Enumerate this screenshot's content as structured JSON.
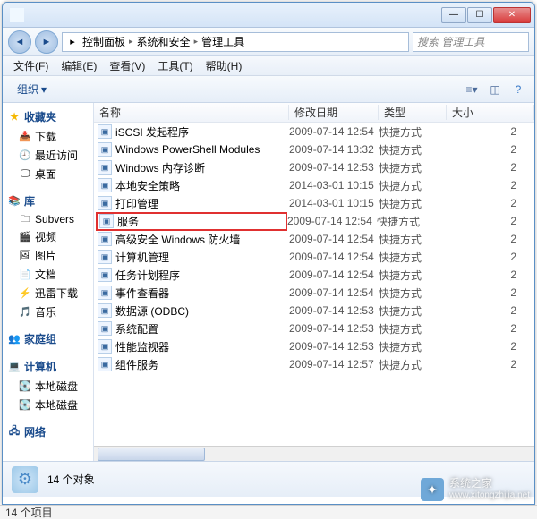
{
  "title": "",
  "win_buttons": {
    "min": "—",
    "max": "☐",
    "close": "✕"
  },
  "breadcrumb": [
    "控制面板",
    "系统和安全",
    "管理工具"
  ],
  "search_placeholder": "搜索 管理工具",
  "menus": [
    "文件(F)",
    "编辑(E)",
    "查看(V)",
    "工具(T)",
    "帮助(H)"
  ],
  "toolbar": {
    "organize": "组织",
    "organize_caret": "▾"
  },
  "sidebar": {
    "favorites": {
      "label": "收藏夹",
      "items": [
        "下载",
        "最近访问",
        "桌面"
      ]
    },
    "library": {
      "label": "库",
      "items": [
        "Subvers",
        "视频",
        "图片",
        "文档",
        "迅雷下载",
        "音乐"
      ]
    },
    "homegroup": {
      "label": "家庭组"
    },
    "computer": {
      "label": "计算机",
      "items": [
        "本地磁盘",
        "本地磁盘"
      ]
    },
    "network": {
      "label": "网络"
    }
  },
  "columns": {
    "name": "名称",
    "date": "修改日期",
    "type": "类型",
    "size": "大小"
  },
  "files": [
    {
      "name": "iSCSI 发起程序",
      "date": "2009-07-14 12:54",
      "type": "快捷方式",
      "size": "2"
    },
    {
      "name": "Windows PowerShell Modules",
      "date": "2009-07-14 13:32",
      "type": "快捷方式",
      "size": "2"
    },
    {
      "name": "Windows 内存诊断",
      "date": "2009-07-14 12:53",
      "type": "快捷方式",
      "size": "2"
    },
    {
      "name": "本地安全策略",
      "date": "2014-03-01 10:15",
      "type": "快捷方式",
      "size": "2"
    },
    {
      "name": "打印管理",
      "date": "2014-03-01 10:15",
      "type": "快捷方式",
      "size": "2"
    },
    {
      "name": "服务",
      "date": "2009-07-14 12:54",
      "type": "快捷方式",
      "size": "2",
      "highlight": true
    },
    {
      "name": "高级安全 Windows 防火墙",
      "date": "2009-07-14 12:54",
      "type": "快捷方式",
      "size": "2"
    },
    {
      "name": "计算机管理",
      "date": "2009-07-14 12:54",
      "type": "快捷方式",
      "size": "2"
    },
    {
      "name": "任务计划程序",
      "date": "2009-07-14 12:54",
      "type": "快捷方式",
      "size": "2"
    },
    {
      "name": "事件查看器",
      "date": "2009-07-14 12:54",
      "type": "快捷方式",
      "size": "2"
    },
    {
      "name": "数据源 (ODBC)",
      "date": "2009-07-14 12:53",
      "type": "快捷方式",
      "size": "2"
    },
    {
      "name": "系统配置",
      "date": "2009-07-14 12:53",
      "type": "快捷方式",
      "size": "2"
    },
    {
      "name": "性能监视器",
      "date": "2009-07-14 12:53",
      "type": "快捷方式",
      "size": "2"
    },
    {
      "name": "组件服务",
      "date": "2009-07-14 12:57",
      "type": "快捷方式",
      "size": "2"
    }
  ],
  "status": {
    "objects": "14 个对象",
    "items": "14 个项目"
  },
  "watermark": {
    "name": "系统之家",
    "url": "www.xitongzhijia.net"
  }
}
